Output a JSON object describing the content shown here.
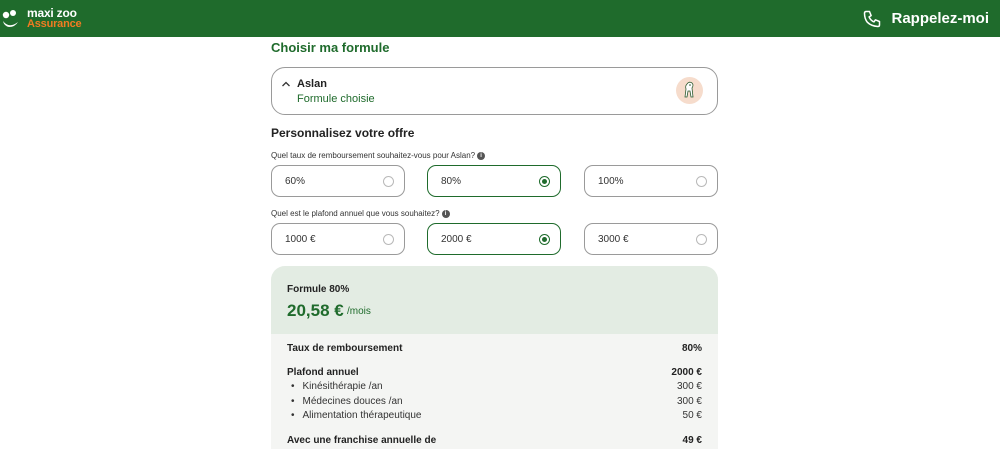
{
  "header": {
    "logo_top": "maxi zoo",
    "logo_bottom": "Assurance",
    "callback_label": "Rappelez-moi",
    "background": "#1f6b2c",
    "accent": "#f07b22"
  },
  "main": {
    "section_title": "Choisir ma formule",
    "pet": {
      "name": "Aslan",
      "status": "Formule choisie"
    },
    "customize_title": "Personnalisez votre offre",
    "reimbursement": {
      "question": "Quel taux de remboursement souhaitez-vous pour Aslan?",
      "options": [
        "60%",
        "80%",
        "100%"
      ],
      "selected": "80%"
    },
    "ceiling": {
      "question": "Quel est le plafond annuel que vous souhaitez?",
      "options": [
        "1000 €",
        "2000 €",
        "3000 €"
      ],
      "selected": "2000 €"
    },
    "summary": {
      "formule": "Formule 80%",
      "price": "20,58 €",
      "per_month": "/mois",
      "rows": [
        {
          "label": "Taux de remboursement",
          "value": "80%"
        },
        {
          "label": "Plafond annuel",
          "value": "2000 €"
        },
        {
          "label": "Kinésithérapie /an",
          "value": "300 €"
        },
        {
          "label": "Médecines douces /an",
          "value": "300 €"
        },
        {
          "label": "Alimentation thérapeutique",
          "value": "50 €"
        },
        {
          "label": "Avec une franchise annuelle de",
          "value": "49 €"
        }
      ]
    }
  }
}
